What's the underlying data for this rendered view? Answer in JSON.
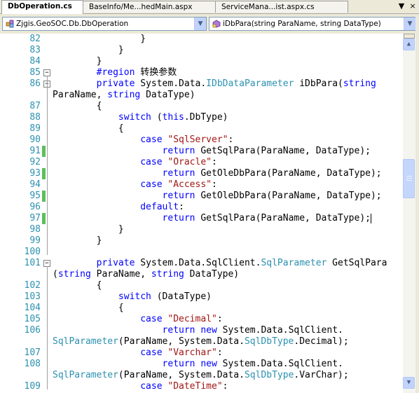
{
  "tabs": [
    {
      "label": "DbOperation.cs",
      "active": true
    },
    {
      "label": "BaseInfo/Me...hedMain.aspx",
      "active": false
    },
    {
      "label": "ServiceMana...ist.aspx.cs",
      "active": false
    }
  ],
  "tab_controls": {
    "pin": "▼",
    "close": "×"
  },
  "nav": {
    "type_combo": "Zjgis.GeoSOC.Db.DbOperation",
    "member_combo": "iDbPara(string ParaName, string DataType)"
  },
  "lines": [
    {
      "num": "82",
      "tokens": [
        {
          "t": "                "
        },
        {
          "t": "}"
        }
      ]
    },
    {
      "num": "83",
      "tokens": [
        {
          "t": "            }"
        }
      ]
    },
    {
      "num": "84",
      "tokens": [
        {
          "t": "        }"
        }
      ]
    },
    {
      "num": "85",
      "fold": "−",
      "tokens": [
        {
          "t": "        "
        },
        {
          "t": "#region",
          "k": "kw"
        },
        {
          "t": " 转换参数"
        }
      ]
    },
    {
      "num": "86",
      "fold": "−",
      "tokens": [
        {
          "t": "        "
        },
        {
          "t": "private",
          "k": "kw"
        },
        {
          "t": " System.Data."
        },
        {
          "t": "IDbDataParameter",
          "k": "ty"
        },
        {
          "t": " iDbPara("
        },
        {
          "t": "string",
          "k": "kw"
        }
      ]
    },
    {
      "num": "",
      "tokens": [
        {
          "t": "ParaName, "
        },
        {
          "t": "string",
          "k": "kw"
        },
        {
          "t": " DataType)"
        }
      ]
    },
    {
      "num": "87",
      "tokens": [
        {
          "t": "        {"
        }
      ]
    },
    {
      "num": "88",
      "tokens": [
        {
          "t": "            "
        },
        {
          "t": "switch",
          "k": "kw"
        },
        {
          "t": " ("
        },
        {
          "t": "this",
          "k": "kw"
        },
        {
          "t": ".DbType)"
        }
      ]
    },
    {
      "num": "89",
      "tokens": [
        {
          "t": "            {"
        }
      ]
    },
    {
      "num": "90",
      "tokens": [
        {
          "t": "                "
        },
        {
          "t": "case",
          "k": "kw"
        },
        {
          "t": " "
        },
        {
          "t": "\"SqlServer\"",
          "k": "st"
        },
        {
          "t": ":"
        }
      ]
    },
    {
      "num": "91",
      "chg": true,
      "tokens": [
        {
          "t": "                    "
        },
        {
          "t": "return",
          "k": "kw"
        },
        {
          "t": " GetSqlPara(ParaName, DataType);"
        }
      ]
    },
    {
      "num": "92",
      "tokens": [
        {
          "t": "                "
        },
        {
          "t": "case",
          "k": "kw"
        },
        {
          "t": " "
        },
        {
          "t": "\"Oracle\"",
          "k": "st"
        },
        {
          "t": ":"
        }
      ]
    },
    {
      "num": "93",
      "chg": true,
      "tokens": [
        {
          "t": "                    "
        },
        {
          "t": "return",
          "k": "kw"
        },
        {
          "t": " GetOleDbPara(ParaName, DataType);"
        }
      ]
    },
    {
      "num": "94",
      "tokens": [
        {
          "t": "                "
        },
        {
          "t": "case",
          "k": "kw"
        },
        {
          "t": " "
        },
        {
          "t": "\"Access\"",
          "k": "st"
        },
        {
          "t": ":"
        }
      ]
    },
    {
      "num": "95",
      "chg": true,
      "tokens": [
        {
          "t": "                    "
        },
        {
          "t": "return",
          "k": "kw"
        },
        {
          "t": " GetOleDbPara(ParaName, DataType);"
        }
      ]
    },
    {
      "num": "96",
      "tokens": [
        {
          "t": "                "
        },
        {
          "t": "default",
          "k": "kw"
        },
        {
          "t": ":"
        }
      ]
    },
    {
      "num": "97",
      "chg": true,
      "caret": true,
      "tokens": [
        {
          "t": "                    "
        },
        {
          "t": "return",
          "k": "kw"
        },
        {
          "t": " GetSqlPara(ParaName, DataType);"
        }
      ]
    },
    {
      "num": "98",
      "tokens": [
        {
          "t": "            }"
        }
      ]
    },
    {
      "num": "99",
      "tokens": [
        {
          "t": "        }"
        }
      ]
    },
    {
      "num": "100",
      "tokens": [
        {
          "t": ""
        }
      ]
    },
    {
      "num": "101",
      "fold": "−",
      "tokens": [
        {
          "t": "        "
        },
        {
          "t": "private",
          "k": "kw"
        },
        {
          "t": " System.Data.SqlClient."
        },
        {
          "t": "SqlParameter",
          "k": "ty"
        },
        {
          "t": " GetSqlPara"
        }
      ]
    },
    {
      "num": "",
      "tokens": [
        {
          "t": "("
        },
        {
          "t": "string",
          "k": "kw"
        },
        {
          "t": " ParaName, "
        },
        {
          "t": "string",
          "k": "kw"
        },
        {
          "t": " DataType)"
        }
      ]
    },
    {
      "num": "102",
      "tokens": [
        {
          "t": "        {"
        }
      ]
    },
    {
      "num": "103",
      "tokens": [
        {
          "t": "            "
        },
        {
          "t": "switch",
          "k": "kw"
        },
        {
          "t": " (DataType)"
        }
      ]
    },
    {
      "num": "104",
      "tokens": [
        {
          "t": "            {"
        }
      ]
    },
    {
      "num": "105",
      "tokens": [
        {
          "t": "                "
        },
        {
          "t": "case",
          "k": "kw"
        },
        {
          "t": " "
        },
        {
          "t": "\"Decimal\"",
          "k": "st"
        },
        {
          "t": ":"
        }
      ]
    },
    {
      "num": "106",
      "tokens": [
        {
          "t": "                    "
        },
        {
          "t": "return",
          "k": "kw"
        },
        {
          "t": " "
        },
        {
          "t": "new",
          "k": "kw"
        },
        {
          "t": " System.Data.SqlClient."
        }
      ]
    },
    {
      "num": "",
      "tokens": [
        {
          "t": "SqlParameter",
          "k": "ty"
        },
        {
          "t": "(ParaName, System.Data."
        },
        {
          "t": "SqlDbType",
          "k": "ty"
        },
        {
          "t": ".Decimal);"
        }
      ]
    },
    {
      "num": "107",
      "tokens": [
        {
          "t": "                "
        },
        {
          "t": "case",
          "k": "kw"
        },
        {
          "t": " "
        },
        {
          "t": "\"Varchar\"",
          "k": "st"
        },
        {
          "t": ":"
        }
      ]
    },
    {
      "num": "108",
      "tokens": [
        {
          "t": "                    "
        },
        {
          "t": "return",
          "k": "kw"
        },
        {
          "t": " "
        },
        {
          "t": "new",
          "k": "kw"
        },
        {
          "t": " System.Data.SqlClient."
        }
      ]
    },
    {
      "num": "",
      "tokens": [
        {
          "t": "SqlParameter",
          "k": "ty"
        },
        {
          "t": "(ParaName, System.Data."
        },
        {
          "t": "SqlDbType",
          "k": "ty"
        },
        {
          "t": ".VarChar);"
        }
      ]
    },
    {
      "num": "109",
      "tokens": [
        {
          "t": "                "
        },
        {
          "t": "case",
          "k": "kw"
        },
        {
          "t": " "
        },
        {
          "t": "\"DateTime\"",
          "k": "st"
        },
        {
          "t": ":"
        }
      ]
    }
  ],
  "scrollbar": {
    "up_arrow": "▲",
    "down_arrow": "▼"
  },
  "colors": {
    "keyword": "#0000ff",
    "type": "#2b91af",
    "string": "#a31515",
    "line_number": "#2b91af",
    "changed_marker": "#5cc05c"
  }
}
